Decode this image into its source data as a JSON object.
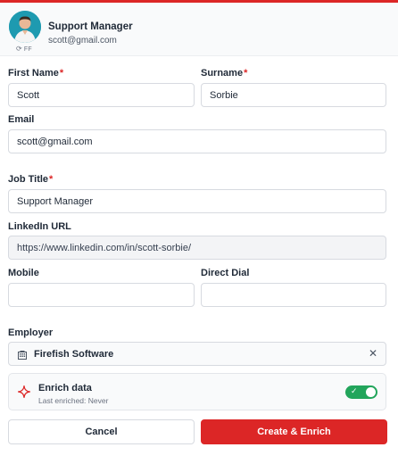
{
  "header": {
    "name": "Support Manager",
    "email": "scott@gmail.com",
    "badge_text": "FF"
  },
  "form": {
    "first_name": {
      "label": "First Name",
      "required_mark": "*",
      "value": "Scott"
    },
    "surname": {
      "label": "Surname",
      "required_mark": "*",
      "value": "Sorbie"
    },
    "email": {
      "label": "Email",
      "value": "scott@gmail.com"
    },
    "job_title": {
      "label": "Job Title",
      "required_mark": "*",
      "value": "Support Manager"
    },
    "linkedin": {
      "label": "LinkedIn URL",
      "value": "https://www.linkedin.com/in/scott-sorbie/"
    },
    "mobile": {
      "label": "Mobile",
      "value": ""
    },
    "direct_dial": {
      "label": "Direct Dial",
      "value": ""
    },
    "employer": {
      "label": "Employer",
      "value": "Firefish Software",
      "clear_glyph": "✕"
    }
  },
  "enrich": {
    "title": "Enrich data",
    "subtitle": "Last enriched: Never",
    "enabled": true,
    "check_glyph": "✓"
  },
  "actions": {
    "cancel_label": "Cancel",
    "create_label": "Create & Enrich"
  },
  "colors": {
    "brand_red": "#dc2626",
    "toggle_green": "#22a55b",
    "avatar_bg": "#1e9ab0"
  }
}
